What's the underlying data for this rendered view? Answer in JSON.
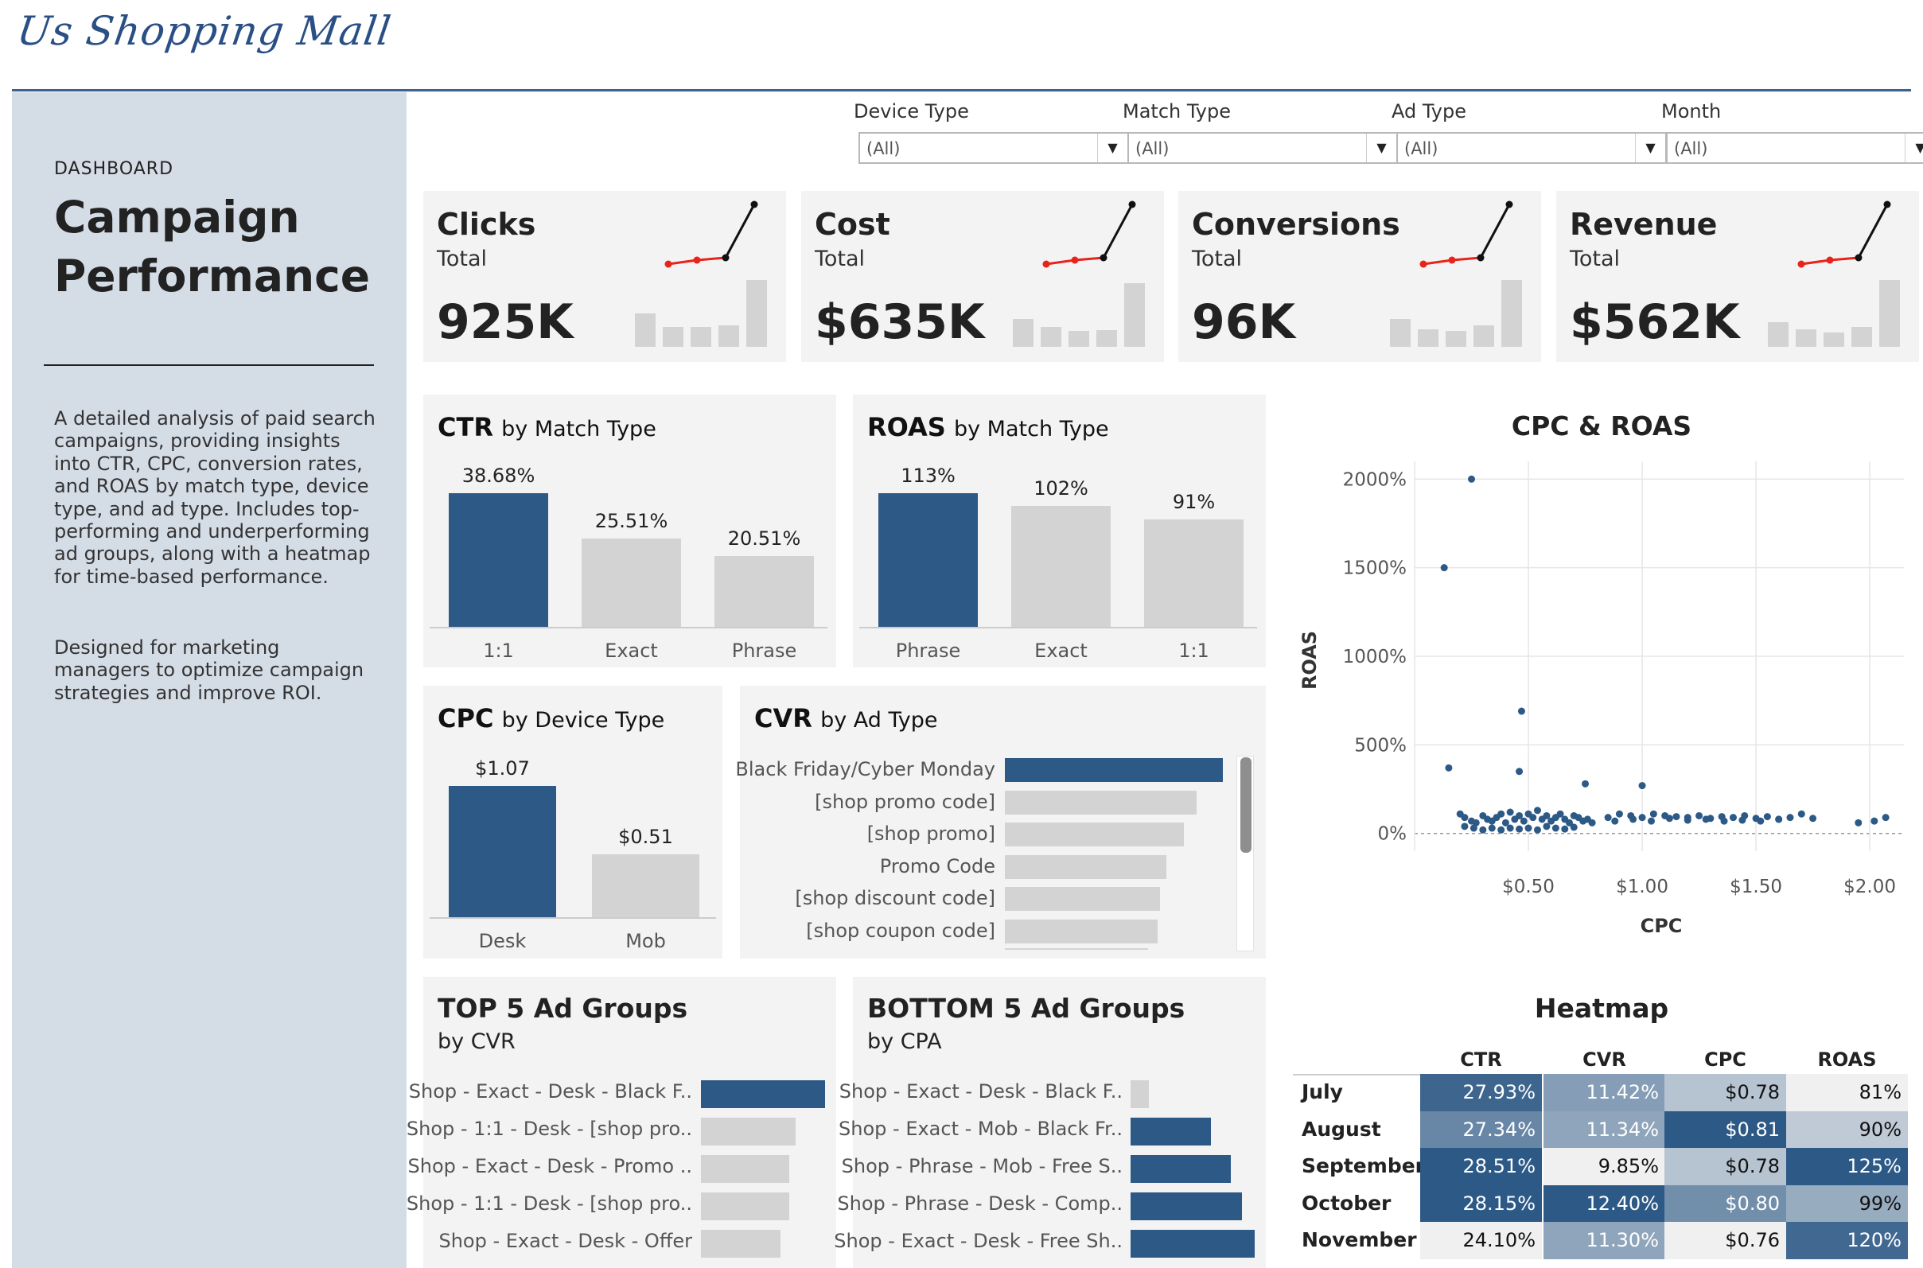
{
  "brand": {
    "logo_text": "Us Shopping Mall"
  },
  "sidebar": {
    "kicker": "DASHBOARD",
    "title_line1": "Campaign",
    "title_line2": "Performance",
    "para1": "A detailed analysis of paid search campaigns, providing insights into CTR, CPC, conversion rates, and ROAS by match type, device type, and ad type. Includes top-performing and underperforming ad groups, along with a heatmap for time-based performance.",
    "para2": "Designed for marketing managers to optimize campaign strategies and improve ROI."
  },
  "filters": [
    {
      "label": "Device Type",
      "value": "(All)"
    },
    {
      "label": "Match Type",
      "value": "(All)"
    },
    {
      "label": "Ad Type",
      "value": "(All)"
    },
    {
      "label": "Month",
      "value": "(All)"
    }
  ],
  "kpis": [
    {
      "name": "Clicks",
      "sub": "Total",
      "value": "925K"
    },
    {
      "name": "Cost",
      "sub": "Total",
      "value": "$635K"
    },
    {
      "name": "Conversions",
      "sub": "Total",
      "value": "96K"
    },
    {
      "name": "Revenue",
      "sub": "Total",
      "value": "$562K"
    }
  ],
  "kpi_sparkline": {
    "line_colors": {
      "trend_up": "#e8231a",
      "latest": "#111111"
    }
  },
  "colors": {
    "accent_blue": "#2d5986",
    "muted_gray": "#d3d3d3",
    "card_bg": "#f3f3f3",
    "sidebar_bg": "#d4dce6"
  },
  "ctr": {
    "title_bold": "CTR",
    "title_rest": "by Match Type"
  },
  "roas": {
    "title_bold": "ROAS",
    "title_rest": "by Match Type"
  },
  "cpc": {
    "title_bold": "CPC",
    "title_rest": "by Device Type"
  },
  "cvr": {
    "title_bold": "CVR",
    "title_rest": "by Ad Type"
  },
  "top5": {
    "title": "TOP 5 Ad Groups",
    "subtitle": "by CVR"
  },
  "bottom5": {
    "title": "BOTTOM 5 Ad Groups",
    "subtitle": "by CPA"
  },
  "scatter": {
    "title": "CPC & ROAS",
    "xlabel": "CPC",
    "ylabel": "ROAS"
  },
  "heatmap": {
    "title": "Heatmap"
  },
  "chart_data": [
    {
      "id": "ctr",
      "type": "bar",
      "categories": [
        "1:1",
        "Exact",
        "Phrase"
      ],
      "values": [
        38.68,
        25.51,
        20.51
      ],
      "labels": [
        "38.68%",
        "25.51%",
        "20.51%"
      ],
      "highlight": [
        true,
        false,
        false
      ]
    },
    {
      "id": "roas",
      "type": "bar",
      "categories": [
        "Phrase",
        "Exact",
        "1:1"
      ],
      "values": [
        113,
        102,
        91
      ],
      "labels": [
        "113%",
        "102%",
        "91%"
      ],
      "highlight": [
        true,
        false,
        false
      ]
    },
    {
      "id": "cpc",
      "type": "bar",
      "categories": [
        "Desk",
        "Mob"
      ],
      "values": [
        1.07,
        0.51
      ],
      "labels": [
        "$1.07",
        "$0.51"
      ],
      "highlight": [
        true,
        false
      ]
    },
    {
      "id": "cvr",
      "type": "bar",
      "orientation": "horizontal",
      "categories": [
        "Black Friday/Cyber Monday",
        "[shop promo code]",
        "[shop promo]",
        "Promo Code",
        "[shop discount code]",
        "[shop coupon code]"
      ],
      "values": [
        100,
        88,
        82,
        74,
        71,
        70
      ],
      "highlight": [
        true,
        false,
        false,
        false,
        false,
        false
      ]
    },
    {
      "id": "top5",
      "type": "bar",
      "orientation": "horizontal",
      "categories": [
        "Shop - Exact - Desk - Black F..",
        "Shop - 1:1 - Desk - [shop pro..",
        "Shop - Exact - Desk - Promo ..",
        "Shop - 1:1 - Desk - [shop pro..",
        "Shop - Exact - Desk - Offer"
      ],
      "values": [
        100,
        76,
        71,
        71,
        64
      ],
      "highlight": [
        true,
        false,
        false,
        false,
        false
      ]
    },
    {
      "id": "bottom5",
      "type": "bar",
      "orientation": "horizontal",
      "categories": [
        "Shop - Exact - Desk - Black F..",
        "Shop - Exact - Mob - Black Fr..",
        "Shop - Phrase - Mob - Free S..",
        "Shop - Phrase - Desk - Comp..",
        "Shop - Exact - Desk - Free Sh.."
      ],
      "values": [
        15,
        65,
        81,
        90,
        100
      ],
      "highlight": [
        false,
        true,
        true,
        true,
        true
      ]
    },
    {
      "id": "kpi_sparkline",
      "type": "line+bar",
      "points": 4,
      "bars_clicks": [
        30,
        18,
        18,
        19,
        60
      ],
      "bars_cost": [
        25,
        18,
        14,
        15,
        57
      ],
      "bars_conv": [
        25,
        16,
        14,
        19,
        60
      ],
      "bars_rev": [
        22,
        16,
        13,
        18,
        60
      ],
      "line": [
        20,
        25,
        28,
        95
      ]
    },
    {
      "id": "scatter",
      "type": "scatter",
      "title": "CPC & ROAS",
      "xlabel": "CPC",
      "ylabel": "ROAS",
      "x_ticks": [
        "$0.50",
        "$1.00",
        "$1.50",
        "$2.00"
      ],
      "y_ticks": [
        "0%",
        "500%",
        "1000%",
        "1500%",
        "2000%"
      ],
      "xlim": [
        0.0,
        2.15
      ],
      "ylim": [
        -100,
        2100
      ],
      "grid": true,
      "points": [
        [
          0.25,
          2000
        ],
        [
          0.13,
          1500
        ],
        [
          0.47,
          690
        ],
        [
          0.15,
          370
        ],
        [
          0.46,
          350
        ],
        [
          0.75,
          280
        ],
        [
          1.0,
          270
        ],
        [
          0.2,
          110
        ],
        [
          0.22,
          90
        ],
        [
          0.25,
          70
        ],
        [
          0.27,
          60
        ],
        [
          0.3,
          100
        ],
        [
          0.32,
          80
        ],
        [
          0.34,
          70
        ],
        [
          0.36,
          90
        ],
        [
          0.38,
          110
        ],
        [
          0.4,
          60
        ],
        [
          0.42,
          120
        ],
        [
          0.44,
          80
        ],
        [
          0.46,
          100
        ],
        [
          0.48,
          70
        ],
        [
          0.5,
          110
        ],
        [
          0.52,
          90
        ],
        [
          0.54,
          130
        ],
        [
          0.56,
          80
        ],
        [
          0.58,
          100
        ],
        [
          0.6,
          70
        ],
        [
          0.62,
          90
        ],
        [
          0.64,
          110
        ],
        [
          0.66,
          80
        ],
        [
          0.68,
          60
        ],
        [
          0.7,
          100
        ],
        [
          0.72,
          90
        ],
        [
          0.74,
          70
        ],
        [
          0.76,
          80
        ],
        [
          0.78,
          60
        ],
        [
          0.22,
          40
        ],
        [
          0.26,
          30
        ],
        [
          0.3,
          20
        ],
        [
          0.34,
          30
        ],
        [
          0.38,
          20
        ],
        [
          0.42,
          30
        ],
        [
          0.46,
          25
        ],
        [
          0.5,
          30
        ],
        [
          0.54,
          20
        ],
        [
          0.58,
          40
        ],
        [
          0.62,
          30
        ],
        [
          0.66,
          25
        ],
        [
          0.7,
          35
        ],
        [
          0.85,
          90
        ],
        [
          0.9,
          110
        ],
        [
          0.95,
          100
        ],
        [
          1.0,
          90
        ],
        [
          1.05,
          110
        ],
        [
          1.1,
          100
        ],
        [
          1.15,
          95
        ],
        [
          1.2,
          90
        ],
        [
          1.25,
          100
        ],
        [
          1.3,
          85
        ],
        [
          1.35,
          95
        ],
        [
          1.4,
          90
        ],
        [
          1.45,
          100
        ],
        [
          1.5,
          85
        ],
        [
          1.55,
          95
        ],
        [
          1.6,
          80
        ],
        [
          1.65,
          90
        ],
        [
          1.7,
          110
        ],
        [
          1.75,
          85
        ],
        [
          1.95,
          60
        ],
        [
          2.02,
          70
        ],
        [
          2.07,
          90
        ],
        [
          0.88,
          70
        ],
        [
          0.96,
          80
        ],
        [
          1.04,
          70
        ],
        [
          1.12,
          85
        ],
        [
          1.2,
          75
        ],
        [
          1.28,
          80
        ],
        [
          1.36,
          70
        ],
        [
          1.44,
          75
        ],
        [
          1.52,
          70
        ],
        [
          1.6,
          80
        ]
      ]
    },
    {
      "id": "heatmap",
      "type": "heatmap",
      "columns": [
        "CTR",
        "CVR",
        "CPC",
        "ROAS"
      ],
      "rows": [
        {
          "label": "July",
          "values": [
            "27.93%",
            "11.42%",
            "$0.78",
            "81%"
          ],
          "shade": [
            0.92,
            0.55,
            0.3,
            0.0
          ]
        },
        {
          "label": "August",
          "values": [
            "27.34%",
            "11.34%",
            "$0.81",
            "90%"
          ],
          "shade": [
            0.7,
            0.5,
            1.0,
            0.25
          ]
        },
        {
          "label": "September",
          "values": [
            "28.51%",
            "9.85%",
            "$0.78",
            "125%"
          ],
          "shade": [
            1.0,
            0.0,
            0.3,
            1.0
          ]
        },
        {
          "label": "October",
          "values": [
            "28.15%",
            "12.40%",
            "$0.80",
            "99%"
          ],
          "shade": [
            1.0,
            1.0,
            0.65,
            0.45
          ]
        },
        {
          "label": "November",
          "values": [
            "24.10%",
            "11.30%",
            "$0.76",
            "120%"
          ],
          "shade": [
            0.0,
            0.5,
            0.0,
            0.9
          ]
        }
      ]
    }
  ]
}
